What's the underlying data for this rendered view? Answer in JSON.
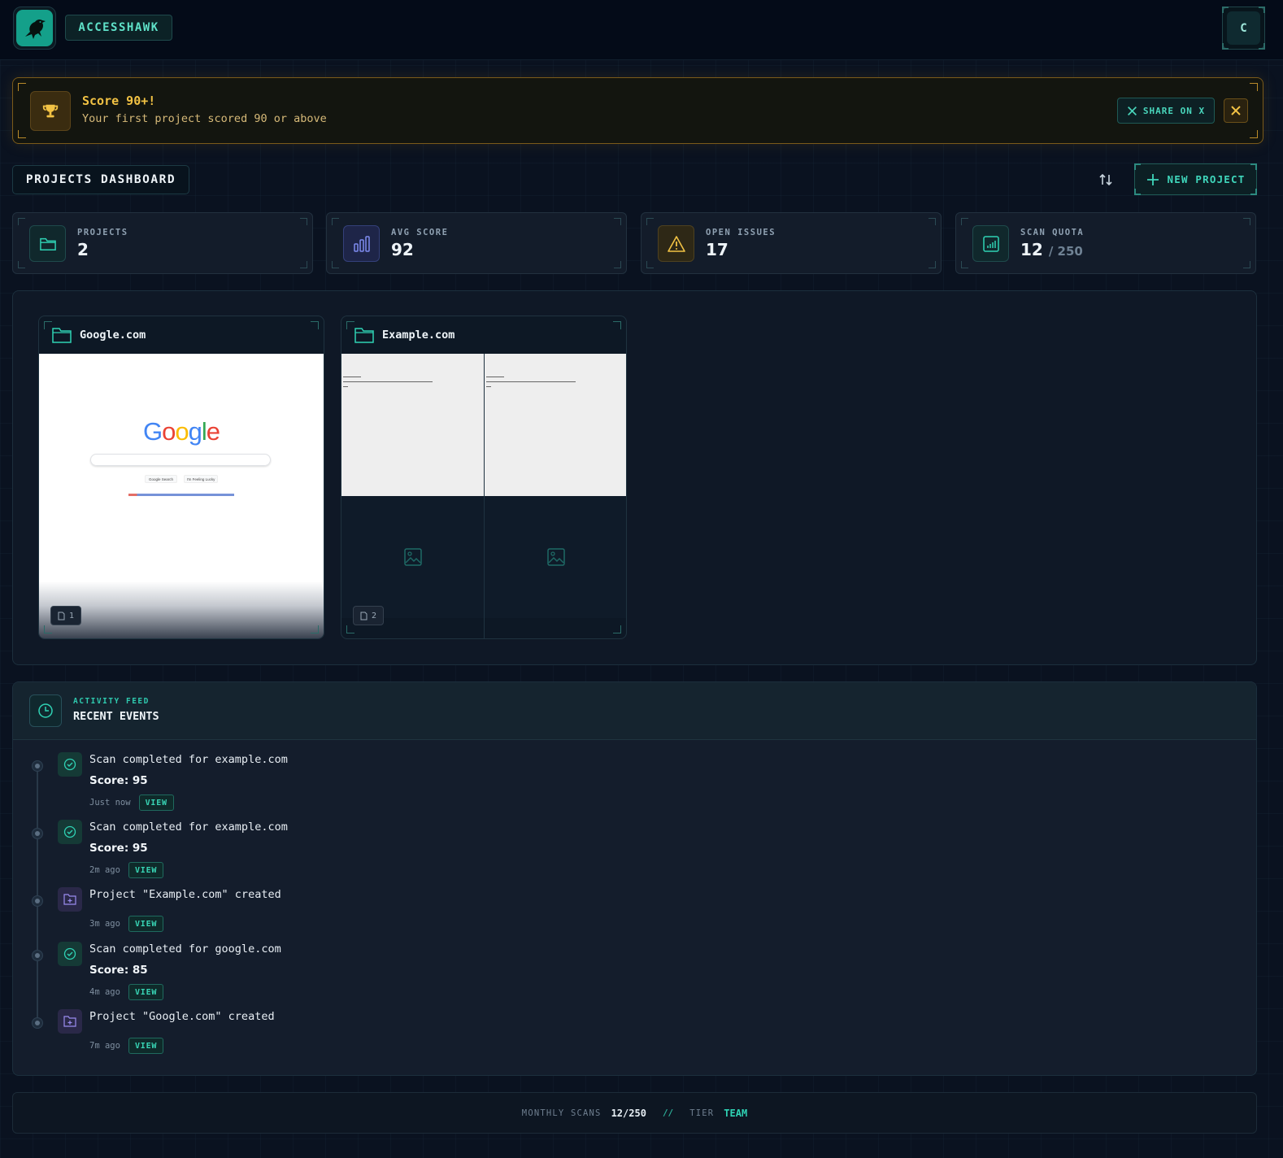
{
  "app": {
    "brand": "ACCESSHAWK",
    "user_initial": "C"
  },
  "banner": {
    "title": "Score 90+!",
    "subtitle": "Your first project scored 90 or above",
    "share_label": "SHARE ON X"
  },
  "dashboard": {
    "title": "PROJECTS DASHBOARD",
    "new_project_label": "NEW PROJECT"
  },
  "stats": [
    {
      "label": "PROJECTS",
      "value": "2"
    },
    {
      "label": "AVG SCORE",
      "value": "92"
    },
    {
      "label": "OPEN ISSUES",
      "value": "17"
    },
    {
      "label": "SCAN QUOTA",
      "value": "12",
      "sub": "/ 250"
    }
  ],
  "projects": [
    {
      "name": "Google.com",
      "pages": "1"
    },
    {
      "name": "Example.com",
      "pages": "2"
    }
  ],
  "thumb_google": {
    "logo": "Google",
    "btn1": "Google Search",
    "btn2": "I'm Feeling Lucky"
  },
  "activity": {
    "kicker": "ACTIVITY FEED",
    "title": "RECENT EVENTS",
    "view_label": "VIEW",
    "events": [
      {
        "text": "Scan completed for example.com",
        "score": "Score: 95",
        "time": "Just now",
        "type": "scan"
      },
      {
        "text": "Scan completed for example.com",
        "score": "Score: 95",
        "time": "2m ago",
        "type": "scan"
      },
      {
        "text": "Project \"Example.com\" created",
        "score": "",
        "time": "3m ago",
        "type": "project"
      },
      {
        "text": "Scan completed for google.com",
        "score": "Score: 85",
        "time": "4m ago",
        "type": "scan"
      },
      {
        "text": "Project \"Google.com\" created",
        "score": "",
        "time": "7m ago",
        "type": "project"
      }
    ]
  },
  "footer": {
    "monthly_label": "MONTHLY SCANS",
    "monthly_value": "12/250",
    "separator": "//",
    "tier_label": "TIER",
    "tier_value": "TEAM"
  },
  "colors": {
    "accent": "#2fd2b4",
    "warning": "#f2c244",
    "background": "#0a1220"
  }
}
